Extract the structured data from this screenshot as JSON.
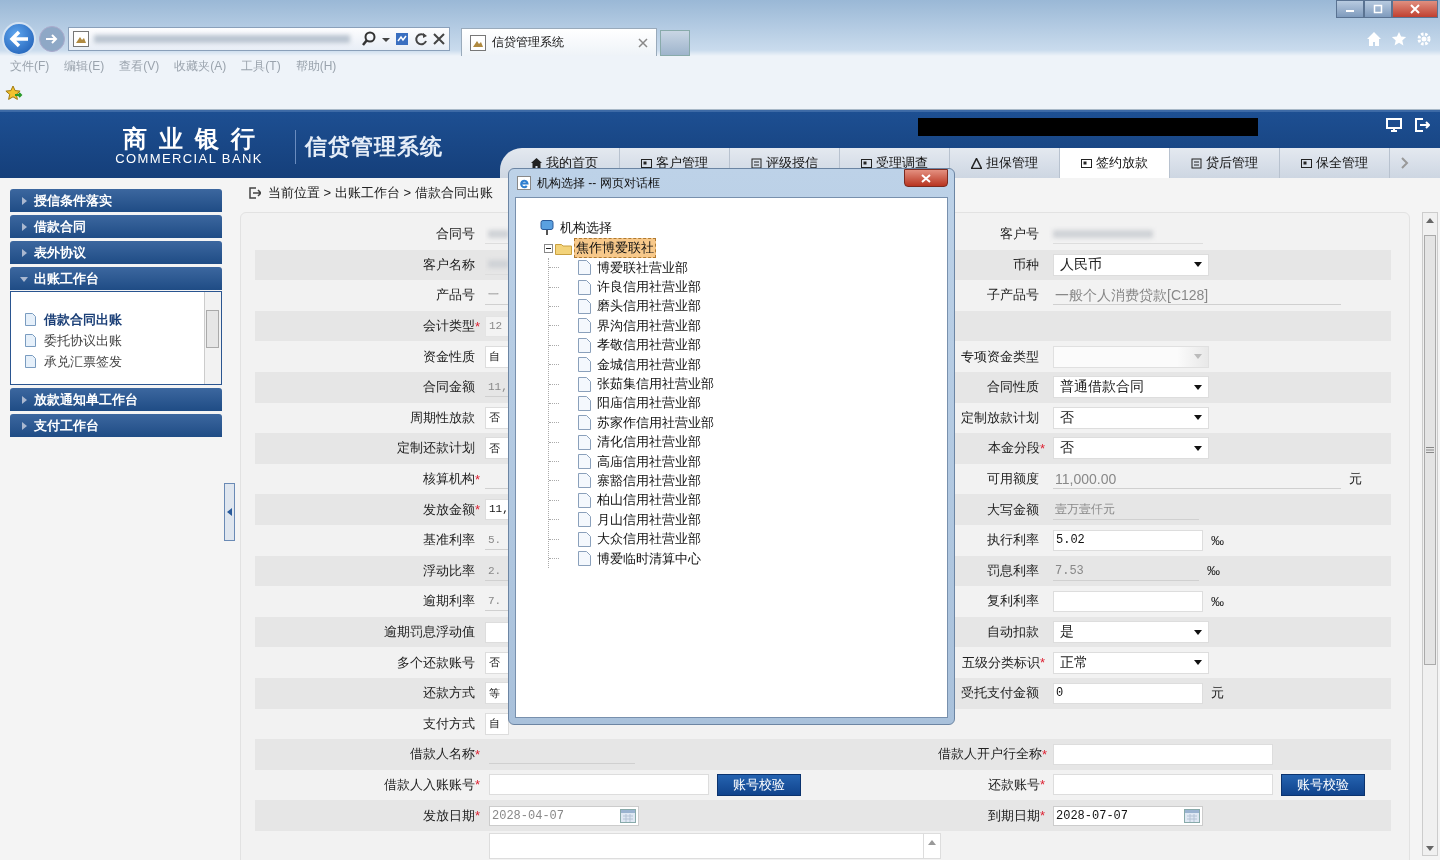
{
  "browser": {
    "tab_title": "信贷管理系统",
    "menu": [
      "文件(F)",
      "编辑(E)",
      "查看(V)",
      "收藏夹(A)",
      "工具(T)",
      "帮助(H)"
    ]
  },
  "header": {
    "bank_name": "商业银行",
    "bank_name_en": "COMMERCIAL BANK",
    "system_name": "信贷管理系统",
    "nav": [
      {
        "label": "我的首页",
        "selected": false
      },
      {
        "label": "客户管理",
        "selected": false
      },
      {
        "label": "评级授信",
        "selected": false
      },
      {
        "label": "受理调查",
        "selected": false
      },
      {
        "label": "担保管理",
        "selected": false
      },
      {
        "label": "签约放款",
        "selected": true
      },
      {
        "label": "贷后管理",
        "selected": false
      },
      {
        "label": "保全管理",
        "selected": false
      }
    ]
  },
  "sidebar": [
    {
      "label": "授信条件落实",
      "expanded": false
    },
    {
      "label": "借款合同",
      "expanded": false
    },
    {
      "label": "表外协议",
      "expanded": false
    },
    {
      "label": "出账工作台",
      "expanded": true,
      "items": [
        {
          "label": "借款合同出账",
          "selected": true
        },
        {
          "label": "委托协议出账",
          "selected": false
        },
        {
          "label": "承兑汇票签发",
          "selected": false
        }
      ]
    },
    {
      "label": "放款通知单工作台",
      "expanded": false
    },
    {
      "label": "支付工作台",
      "expanded": false
    }
  ],
  "breadcrumb": "当前位置 > 出账工作台 > 借款合同出账",
  "form": {
    "rows": [
      {
        "left": {
          "label": "合同号",
          "kind": "masked"
        },
        "right": {
          "label": "客户号",
          "kind": "masked"
        }
      },
      {
        "left": {
          "label": "客户名称",
          "kind": "masked"
        },
        "right": {
          "label": "币种",
          "kind": "select",
          "value": "人民币",
          "disabled": false
        }
      },
      {
        "left": {
          "label": "产品号",
          "kind": "readonly",
          "value": "一"
        },
        "right": {
          "label": "子产品号",
          "kind": "readonly",
          "value": "一般个人消费贷款[C128]"
        }
      },
      {
        "left": {
          "label": "会计类型",
          "required_mark": "*",
          "kind": "input",
          "value": "12",
          "disabled": true
        }
      },
      {
        "left": {
          "label": "资金性质",
          "kind": "select",
          "value": "自",
          "disabled": false
        },
        "right": {
          "label": "专项资金类型",
          "kind": "select",
          "disabled": true
        }
      },
      {
        "left": {
          "label": "合同金额",
          "kind": "readonly",
          "value": "11,"
        },
        "right": {
          "label": "合同性质",
          "kind": "select",
          "value": "普通借款合同",
          "disabled": false
        }
      },
      {
        "left": {
          "label": "周期性放款",
          "kind": "select",
          "value": "否",
          "disabled": false
        },
        "right": {
          "label": "定制放款计划",
          "kind": "select",
          "value": "否",
          "disabled": false
        }
      },
      {
        "left": {
          "label": "定制还款计划",
          "kind": "select",
          "value": "否",
          "disabled": false
        },
        "right": {
          "label": "本金分段",
          "required_mark": "*",
          "kind": "select",
          "value": "否",
          "disabled": false
        }
      },
      {
        "left": {
          "label": "核算机构",
          "required_mark": "*",
          "kind": "readonly"
        },
        "right": {
          "label": "可用额度",
          "kind": "readonly",
          "value": "11,000.00",
          "unit": "元"
        }
      },
      {
        "left": {
          "label": "发放金额",
          "required_mark": "*",
          "kind": "input",
          "value": "11,",
          "disabled": false
        },
        "right": {
          "label": "大写金额",
          "kind": "readonly",
          "value": "壹万壹仟元"
        }
      },
      {
        "left": {
          "label": "基准利率",
          "kind": "readonly",
          "value": "5."
        },
        "right": {
          "label": "执行利率",
          "kind": "input",
          "value": "5.02",
          "disabled": false,
          "unit": "‰"
        }
      },
      {
        "left": {
          "label": "浮动比率",
          "kind": "readonly",
          "value": "2."
        },
        "right": {
          "label": "罚息利率",
          "kind": "readonly",
          "value": "7.53",
          "unit": "‰"
        }
      },
      {
        "left": {
          "label": "逾期利率",
          "kind": "readonly",
          "value": "7."
        },
        "right": {
          "label": "复利利率",
          "kind": "input",
          "disabled": false,
          "unit": "‰"
        }
      },
      {
        "left": {
          "label": "逾期罚息浮动值",
          "kind": "input",
          "disabled": false
        },
        "right": {
          "label": "自动扣款",
          "kind": "select",
          "value": "是",
          "disabled": false
        }
      },
      {
        "left": {
          "label": "多个还款账号",
          "kind": "select",
          "value": "否",
          "disabled": false
        },
        "right": {
          "label": "五级分类标识",
          "required_mark": "*",
          "kind": "select",
          "value": "正常",
          "disabled": false
        }
      },
      {
        "left": {
          "label": "还款方式",
          "kind": "select",
          "value": "等",
          "disabled": false
        },
        "right": {
          "label": "受托支付金额",
          "kind": "input",
          "value": "0",
          "disabled": false,
          "unit": "元"
        }
      },
      {
        "left": {
          "label": "支付方式",
          "kind": "select",
          "value": "自",
          "disabled": false
        }
      },
      {
        "left": {
          "label": "借款人名称",
          "required_mark": "*",
          "kind": "readonly"
        },
        "right": {
          "label": "借款人开户行全称",
          "required_mark": "*",
          "kind": "input",
          "disabled": false
        }
      },
      {
        "left": {
          "label": "借款人入账账号",
          "required_mark": "*",
          "kind": "input",
          "disabled": false,
          "button": "账号校验"
        },
        "right": {
          "label": "还款账号",
          "required_mark": "*",
          "kind": "input",
          "disabled": false,
          "button": "账号校验"
        }
      },
      {
        "left": {
          "label": "发放日期",
          "required_mark": "*",
          "kind": "date",
          "value": "2028-04-07",
          "disabled": true
        },
        "right": {
          "label": "到期日期",
          "required_mark": "*",
          "kind": "date",
          "value": "2028-07-07",
          "disabled": false
        }
      },
      {
        "left": {
          "kind": "textarea"
        }
      }
    ]
  },
  "dialog": {
    "title": "机构选择 -- 网页对话框",
    "tree": {
      "label": "机构选择",
      "children": [
        {
          "label": "焦作博爱联社",
          "expanded": true,
          "selected": true,
          "children": [
            {
              "label": "博爱联社营业部",
              "selected": false
            },
            {
              "label": "许良信用社营业部",
              "selected": false
            },
            {
              "label": "磨头信用社营业部",
              "selected": false
            },
            {
              "label": "界沟信用社营业部",
              "selected": false
            },
            {
              "label": "孝敬信用社营业部",
              "selected": false
            },
            {
              "label": "金城信用社营业部",
              "selected": false
            },
            {
              "label": "张茹集信用社营业部",
              "selected": false
            },
            {
              "label": "阳庙信用社营业部",
              "selected": false
            },
            {
              "label": "苏家作信用社营业部",
              "selected": false
            },
            {
              "label": "清化信用社营业部",
              "selected": false
            },
            {
              "label": "高庙信用社营业部",
              "selected": false
            },
            {
              "label": "寨豁信用社营业部",
              "selected": false
            },
            {
              "label": "柏山信用社营业部",
              "selected": false
            },
            {
              "label": "月山信用社营业部",
              "selected": false
            },
            {
              "label": "大众信用社营业部",
              "selected": false
            },
            {
              "label": "博爱临时清算中心",
              "selected": false
            }
          ]
        }
      ]
    }
  }
}
